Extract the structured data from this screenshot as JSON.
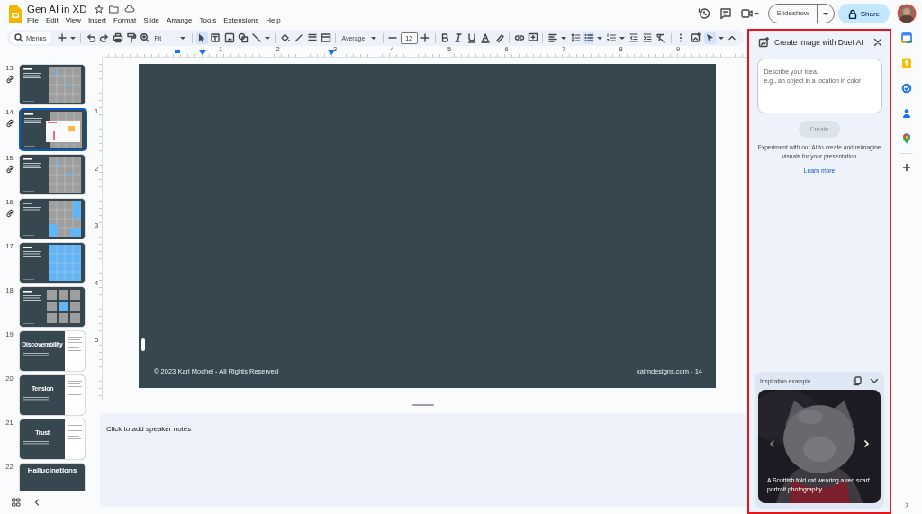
{
  "document": {
    "title": "Gen AI in XD"
  },
  "menu": [
    "File",
    "Edit",
    "View",
    "Insert",
    "Format",
    "Slide",
    "Arrange",
    "Tools",
    "Extensions",
    "Help"
  ],
  "header": {
    "slideshow": "Slideshow",
    "share": "Share"
  },
  "toolbar": {
    "search_placeholder": "Menus",
    "zoom": "Fit",
    "line_weight": "Average",
    "font_size": "12",
    "select_tool_selected": true,
    "bulleted_list_selected": true,
    "pointer_mode_selected": true
  },
  "ruler": {
    "horizontal": [
      "1",
      "2",
      "3",
      "4",
      "5",
      "6",
      "7",
      "8",
      "9"
    ],
    "vertical": [
      "1",
      "2",
      "3",
      "4",
      "5"
    ]
  },
  "filmstrip": [
    {
      "number": "13",
      "linked": true,
      "selected": false,
      "kind": "grid"
    },
    {
      "number": "14",
      "linked": true,
      "selected": true,
      "kind": "screens"
    },
    {
      "number": "15",
      "linked": true,
      "selected": false,
      "kind": "grid"
    },
    {
      "number": "16",
      "linked": true,
      "selected": false,
      "kind": "mixed"
    },
    {
      "number": "17",
      "linked": false,
      "selected": false,
      "kind": "blue"
    },
    {
      "number": "18",
      "linked": false,
      "selected": false,
      "kind": "tiles"
    },
    {
      "number": "19",
      "linked": false,
      "selected": false,
      "kind": "split",
      "title": "Discoverability"
    },
    {
      "number": "20",
      "linked": false,
      "selected": false,
      "kind": "split",
      "title": "Tension"
    },
    {
      "number": "21",
      "linked": false,
      "selected": false,
      "kind": "split",
      "title": "Trust"
    },
    {
      "number": "22",
      "linked": false,
      "selected": false,
      "kind": "band",
      "title": "Hallucinations"
    }
  ],
  "slide": {
    "footer_left": "© 2023 Karl Mochel - All Rights Reserved",
    "footer_right": "kalmdesigns.com - 14"
  },
  "notes": {
    "placeholder": "Click to add speaker notes"
  },
  "panel": {
    "title": "Create image with Duet AI",
    "prompt_placeholder": "Describe your idea.\ne.g., an object in a location in color",
    "create": "Create",
    "create_disabled": true,
    "info": "Experiment with our AI to create and reimagine visuals for your presentation",
    "learn_more": "Learn more",
    "inspiration": {
      "label": "Inspiration example",
      "expanded": true,
      "caption": "A Scottish fold cat wearing a red scarf portrait photography"
    }
  }
}
